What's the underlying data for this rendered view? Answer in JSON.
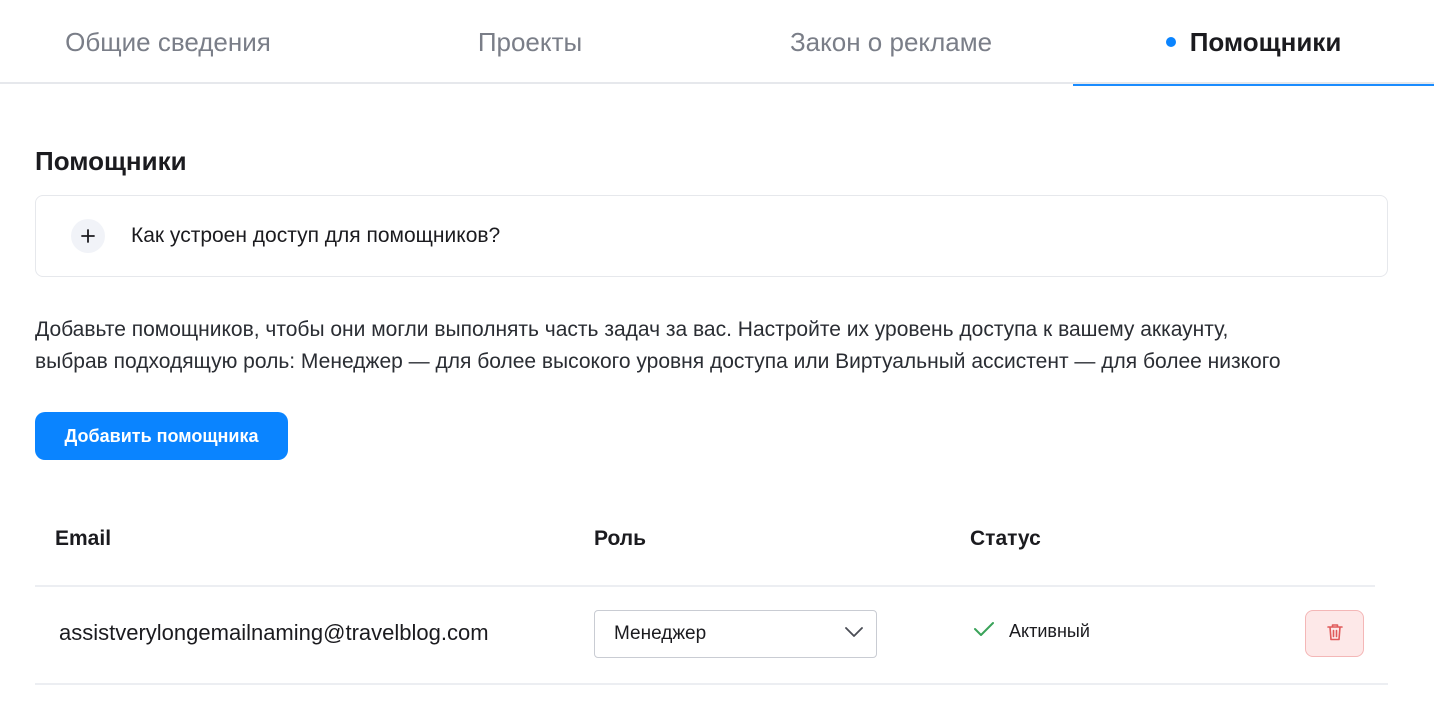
{
  "tabs": [
    {
      "label": "Общие сведения"
    },
    {
      "label": "Проекты"
    },
    {
      "label": "Закон о рекламе"
    },
    {
      "label": "Помощники",
      "active": true
    }
  ],
  "section": {
    "title": "Помощники"
  },
  "accordion": {
    "question": "Как устроен доступ для помощников?",
    "icon": "plus-icon"
  },
  "description": {
    "line1": "Добавьте помощников, чтобы они могли выполнять часть задач за вас. Настройте их уровень доступа к вашему аккаунту,",
    "line2": "выбрав подходящую роль: Менеджер — для более высокого уровня доступа или Виртуальный ассистент — для более низкого"
  },
  "add_button": {
    "label": "Добавить помощника"
  },
  "table": {
    "headers": {
      "email": "Email",
      "role": "Роль",
      "status": "Статус"
    },
    "rows": [
      {
        "email": "assistverylongemailnaming@travelblog.com",
        "role": "Менеджер",
        "status": "Активный",
        "status_icon": "check-icon"
      }
    ]
  },
  "colors": {
    "accent": "#0a84ff",
    "active_status": "#3aa35a",
    "delete": "#e05a5a",
    "delete_bg": "#fde8e8"
  }
}
